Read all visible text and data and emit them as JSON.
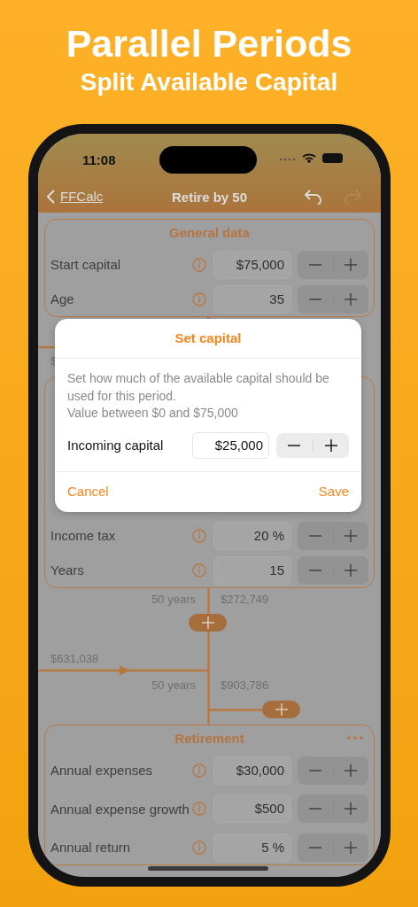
{
  "headline": {
    "title": "Parallel Periods",
    "subtitle": "Split Available Capital"
  },
  "status_bar": {
    "time": "11:08"
  },
  "nav": {
    "back": "FFCalc",
    "title": "Retire by 50",
    "undo_disabled": false,
    "redo_disabled": true
  },
  "general_card": {
    "title": "General data",
    "menu": false,
    "rows": [
      {
        "label": "Start capital",
        "value": "$75,000"
      },
      {
        "label": "Age",
        "value": "35"
      }
    ]
  },
  "split_connector": {
    "amount": "$"
  },
  "period_card": {
    "rows": [
      {
        "label": "Income tax",
        "value": "20 %"
      },
      {
        "label": "Years",
        "value": "15"
      }
    ]
  },
  "merge": {
    "years_1": "50 years",
    "amount_1": "$272,749",
    "incoming": "$631,038",
    "years_2": "50 years",
    "amount_2": "$903,786"
  },
  "retirement_card": {
    "title": "Retirement",
    "menu": true,
    "rows": [
      {
        "label": "Annual expenses",
        "value": "$30,000"
      },
      {
        "label": "Annual expense growth",
        "value": "$500"
      },
      {
        "label": "Annual return",
        "value": "5 %"
      }
    ]
  },
  "dialog": {
    "title": "Set capital",
    "message": [
      "Set how much of the available capital should be used for this period.",
      "Value between $0 and $75,000"
    ],
    "field": {
      "label": "Incoming capital",
      "value": "$25,000"
    },
    "buttons": [
      {
        "label": "Cancel",
        "kind": "cancel"
      },
      {
        "label": "Save",
        "kind": "confirm"
      }
    ]
  }
}
